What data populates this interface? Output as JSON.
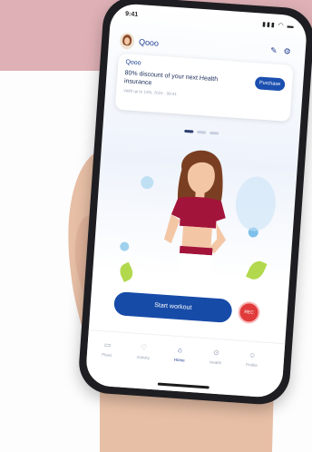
{
  "colors": {
    "background": "#fdfdfd",
    "pink_block": "#dfb1b6",
    "brand_blue": "#1b4fb0",
    "record_red": "#e03a3a",
    "accent_green": "#b2d84d"
  },
  "status_bar": {
    "time": "9:41",
    "indicators": "▮▮▮ ◠ ▬"
  },
  "app": {
    "name": "Qooo",
    "icon_edit": "✎",
    "icon_settings": "⚙"
  },
  "notification": {
    "sender": "Qooo",
    "message": "80% discount of your next Health insurance",
    "subtext": "Valid up to 12th, 2024 · 09:41",
    "action_label": "Purchase"
  },
  "avatar_screen": {
    "start_button": "Start workout",
    "record_button": "REC"
  },
  "tab_bar": {
    "tabs": [
      {
        "icon": "▭",
        "label": "Plans"
      },
      {
        "icon": "♡",
        "label": "Activity"
      },
      {
        "icon": "⌂",
        "label": "Home"
      },
      {
        "icon": "⊙",
        "label": "Health"
      },
      {
        "icon": "☺",
        "label": "Profile"
      }
    ],
    "active_index": 2
  }
}
